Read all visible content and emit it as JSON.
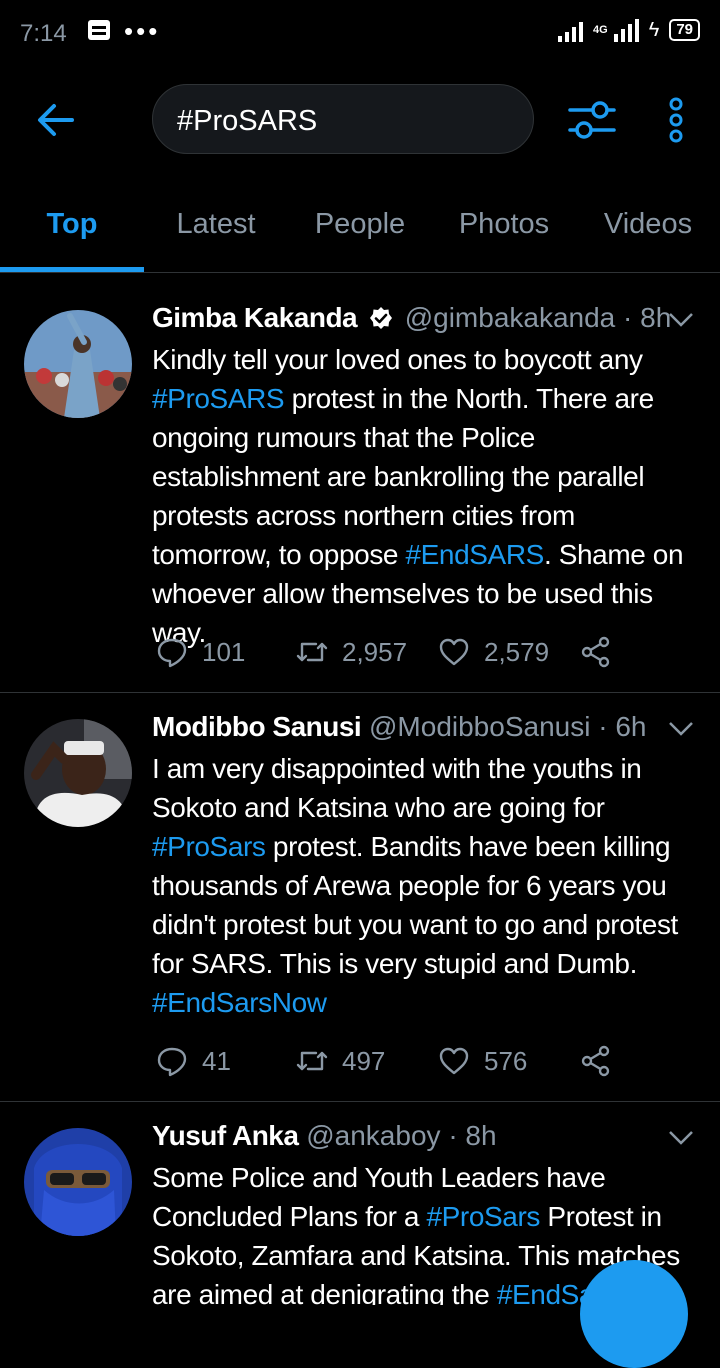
{
  "status": {
    "time": "7:14",
    "dots": "•••",
    "network": "4G",
    "battery": "79"
  },
  "search": {
    "query": "#ProSARS"
  },
  "tabs": [
    {
      "label": "Top",
      "active": true
    },
    {
      "label": "Latest"
    },
    {
      "label": "People"
    },
    {
      "label": "Photos"
    },
    {
      "label": "Videos"
    }
  ],
  "tweets": [
    {
      "name": "Gimba Kakanda",
      "handle": "@gimbakakanda",
      "sep": "·",
      "time": "8h",
      "verified": true,
      "parts": [
        {
          "text": "Kindly tell your loved ones to boycott any "
        },
        {
          "text": "#ProSARS",
          "tag": true
        },
        {
          "text": " protest in the North. There are ongoing rumours that the Police establishment are bankrolling the parallel protests across northern cities from tomorrow, to oppose "
        },
        {
          "text": "#EndSARS",
          "tag": true
        },
        {
          "text": ". Shame on whoever allow themselves to be used this way."
        }
      ],
      "replies": "101",
      "retweets": "2,957",
      "likes": "2,579"
    },
    {
      "name": "Modibbo Sanusi",
      "handle": "@ModibboSanusi",
      "sep": "·",
      "time": "6h",
      "verified": false,
      "parts": [
        {
          "text": "I am very disappointed with the youths in Sokoto and Katsina who are going for "
        },
        {
          "text": "#ProSars",
          "tag": true
        },
        {
          "text": " protest. Bandits have been killing thousands of Arewa people for 6 years you didn't protest but you want to go and protest for SARS. This is very stupid and Dumb. "
        },
        {
          "text": "#EndSarsNow",
          "tag": true
        }
      ],
      "replies": "41",
      "retweets": "497",
      "likes": "576"
    },
    {
      "name": "Yusuf Anka",
      "handle": "@ankaboy",
      "sep": "·",
      "time": "8h",
      "verified": false,
      "parts": [
        {
          "text": "Some Police and Youth Leaders have Concluded Plans for a "
        },
        {
          "text": "#ProSars",
          "tag": true
        },
        {
          "text": " Protest in Sokoto, Zamfara and Katsina. This matches are aimed at denigrating the "
        },
        {
          "text": "#EndSa",
          "tag": true
        }
      ]
    }
  ]
}
